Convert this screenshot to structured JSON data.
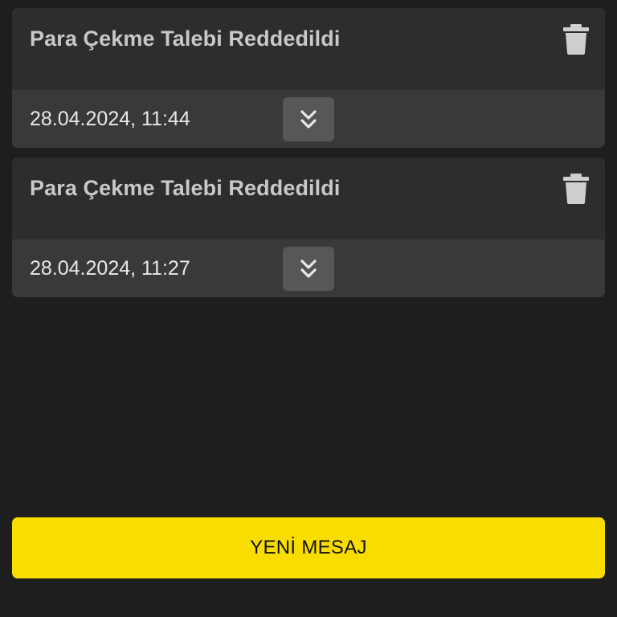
{
  "messages": [
    {
      "title": "Para Çekme Talebi Reddedildi",
      "date": "28.04.2024, 11:44",
      "delete_icon": "trash-icon",
      "expand_icon": "chevron-double-down-icon"
    },
    {
      "title": "Para Çekme Talebi Reddedildi",
      "date": "28.04.2024, 11:27",
      "delete_icon": "trash-icon",
      "expand_icon": "chevron-double-down-icon"
    }
  ],
  "new_message_button": {
    "label": "YENİ MESAJ"
  },
  "colors": {
    "background": "#1e1e1e",
    "card_header": "#2d2d2d",
    "card_footer": "#393939",
    "expand_button": "#575757",
    "accent": "#fadd00",
    "title_text": "#c8c8c8",
    "date_text": "#e8e8e8"
  }
}
